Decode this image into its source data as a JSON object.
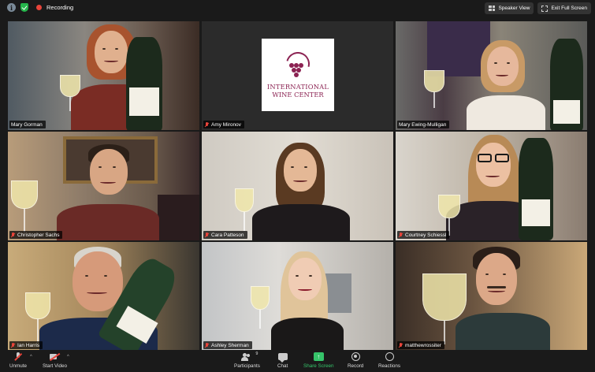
{
  "topbar": {
    "recording_label": "Recording",
    "speaker_view_label": "Speaker View",
    "exit_fullscreen_label": "Exit Full Screen"
  },
  "participants": [
    {
      "name": "Mary Gorman"
    },
    {
      "name": "Amy Mironov"
    },
    {
      "name": "Mary Ewing-Mulligan"
    },
    {
      "name": "Christopher Sachs"
    },
    {
      "name": "Cara Patteson"
    },
    {
      "name": "Courtney Schiessl"
    },
    {
      "name": "Ian Harris"
    },
    {
      "name": "Ashley Sherman"
    },
    {
      "name": "matthewrossiter"
    }
  ],
  "logo": {
    "line1": "INTERNATIONAL",
    "line2": "WINE CENTER",
    "brand_color": "#8b2252"
  },
  "toolbar": {
    "unmute_label": "Unmute",
    "start_video_label": "Start Video",
    "participants_label": "Participants",
    "participants_count": "9",
    "chat_label": "Chat",
    "share_screen_label": "Share Screen",
    "record_label": "Record",
    "reactions_label": "Reactions"
  },
  "colors": {
    "active_speaker_border": "#b9d84a",
    "recording_dot": "#e8443a",
    "share_green": "#36c46a"
  }
}
